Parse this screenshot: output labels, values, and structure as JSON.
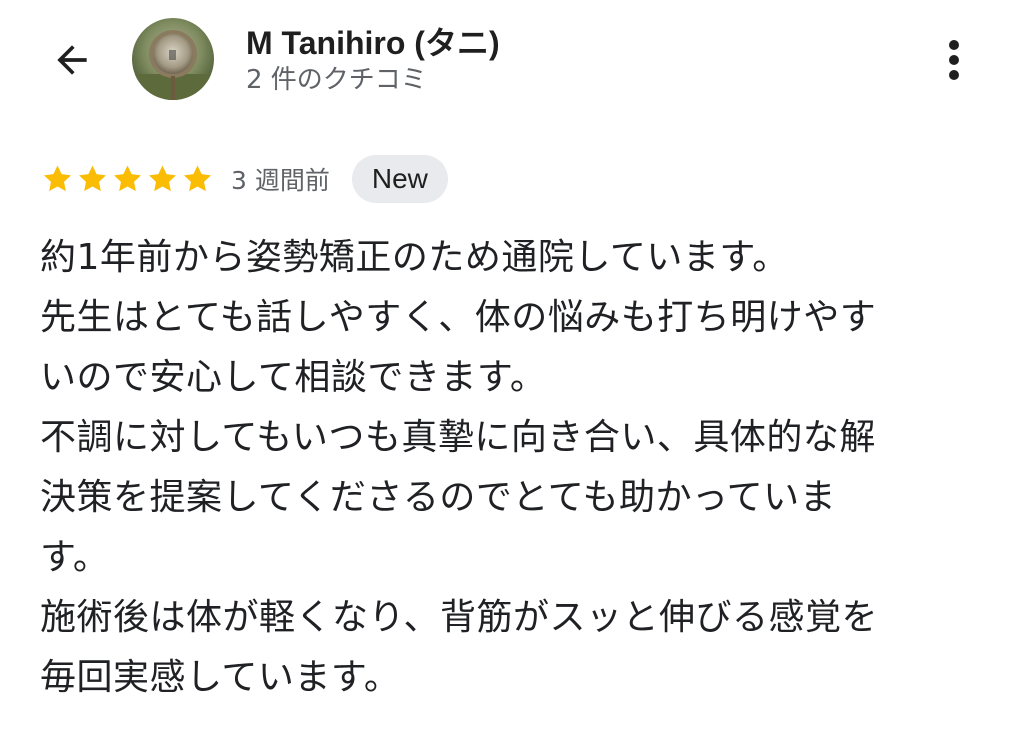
{
  "header": {
    "back_icon": "arrow-left-icon",
    "user_name": "M Tanihiro (タニ)",
    "review_count": "2 件のクチコミ",
    "more_icon": "more-vert-icon"
  },
  "review": {
    "rating": 5,
    "max_rating": 5,
    "star_color": "#fbbc04",
    "time_ago": "3 週間前",
    "badge": "New",
    "text_lines": [
      "約1年前から姿勢矯正のため通院しています。",
      "先生はとても話しやすく、体の悩みも打ち明けやす",
      "いので安心して相談できます。",
      "不調に対してもいつも真摯に向き合い、具体的な解",
      "決策を提案してくださるのでとても助かっていま",
      "す。",
      "施術後は体が軽くなり、背筋がスッと伸びる感覚を",
      "毎回実感しています。"
    ]
  }
}
